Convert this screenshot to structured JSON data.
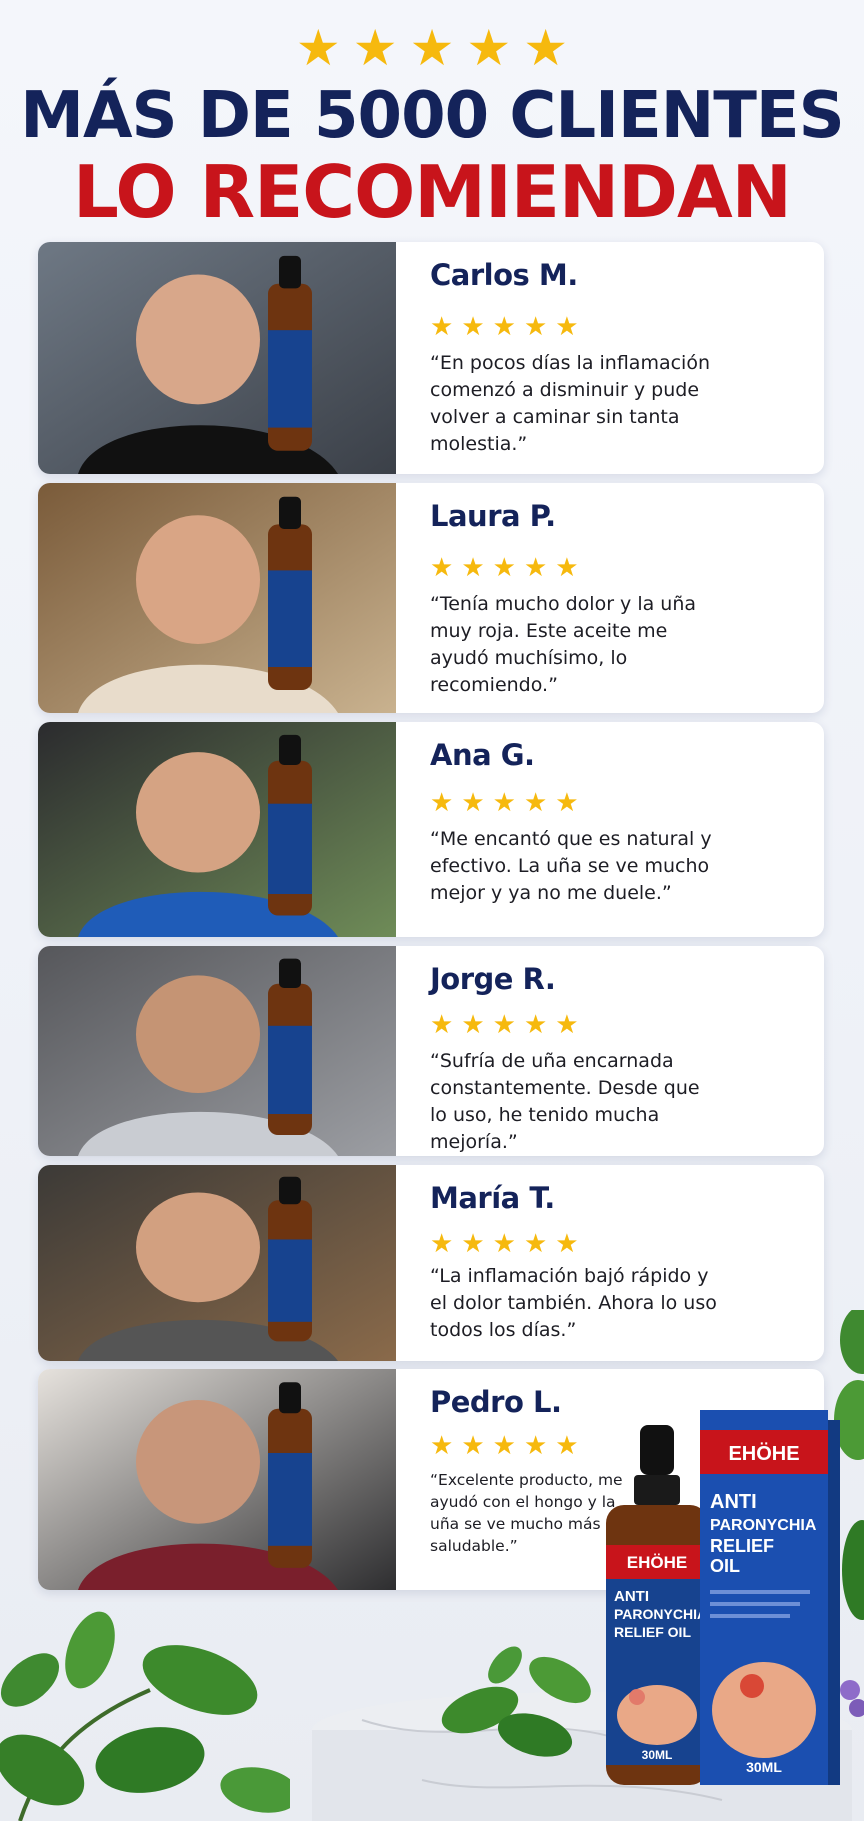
{
  "header": {
    "stars": [
      "★",
      "★",
      "★",
      "★",
      "★"
    ],
    "line1": "MÁS DE 5000 CLIENTES",
    "line2": "LO RECOMIENDAN"
  },
  "reviews": [
    {
      "name": "Carlos M.",
      "rating": 5,
      "quote": "“En pocos días la inflamación comenzó a disminuir y pude volver a caminar sin tanta molestia.”"
    },
    {
      "name": "Laura P.",
      "rating": 5,
      "quote": "“Tenía mucho dolor y la uña muy roja. Este aceite me ayudó muchísimo, lo recomiendo.”"
    },
    {
      "name": "Ana G.",
      "rating": 5,
      "quote": "“Me encantó que es natural y efectivo. La uña se ve mucho mejor y ya no me duele.”"
    },
    {
      "name": "Jorge R.",
      "rating": 5,
      "quote": "“Sufría de uña encarnada constantemente. Desde que lo uso, he tenido mucha mejoría.”"
    },
    {
      "name": "María T.",
      "rating": 5,
      "quote": "“La inflamación bajó rápido y el dolor también. Ahora lo uso todos los días.”"
    },
    {
      "name": "Pedro L.",
      "rating": 5,
      "quote": "“Excelente producto, me ayudó con el hongo y la uña se ve mucho más saludable.”"
    }
  ],
  "product": {
    "brand": "EHÖHE",
    "name_line1": "ANTI",
    "name_line2": "PARONYCHIA",
    "name_line3": "RELIEF",
    "name_line4": "OIL",
    "bottle_name_line3": "RELIEF OIL",
    "volume": "30ML",
    "colors": {
      "navy": "#14235a",
      "red": "#c8141b",
      "gold": "#f6b90e",
      "box_blue": "#1b4fb0",
      "amber": "#7a3a12"
    }
  }
}
